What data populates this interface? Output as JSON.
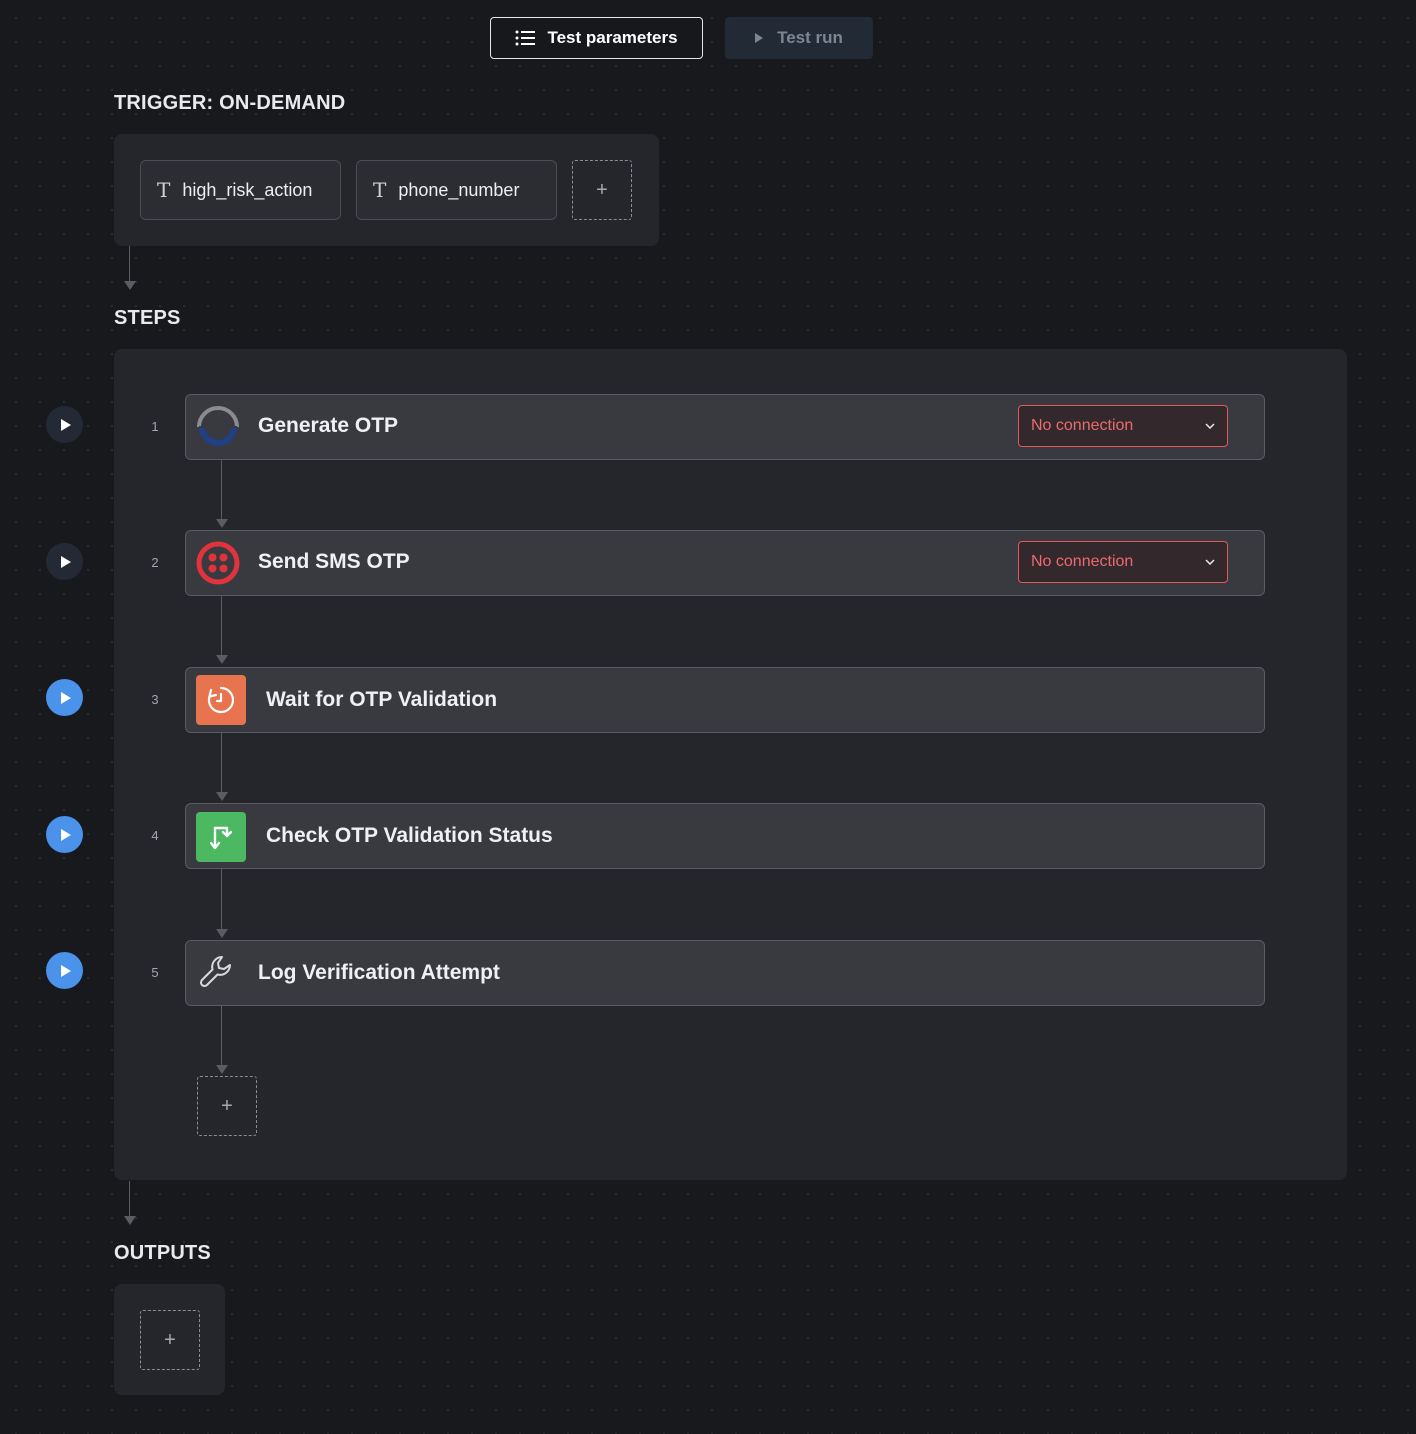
{
  "toolbar": {
    "test_parameters_label": "Test parameters",
    "test_run_label": "Test run"
  },
  "trigger": {
    "title": "TRIGGER: ON-DEMAND",
    "params": [
      {
        "name": "high_risk_action",
        "type_icon": "text-type-icon"
      },
      {
        "name": "phone_number",
        "type_icon": "text-type-icon"
      }
    ],
    "add_label": "+"
  },
  "steps": {
    "title": "STEPS",
    "items": [
      {
        "number": "1",
        "title": "Generate OTP",
        "icon": "loading-ring-icon",
        "connection": "No connection",
        "play_style": "inactive"
      },
      {
        "number": "2",
        "title": "Send SMS OTP",
        "icon": "twilio-icon",
        "connection": "No connection",
        "play_style": "inactive"
      },
      {
        "number": "3",
        "title": "Wait for OTP Validation",
        "icon": "timer-icon",
        "play_style": "active"
      },
      {
        "number": "4",
        "title": "Check OTP Validation Status",
        "icon": "branch-icon",
        "play_style": "active"
      },
      {
        "number": "5",
        "title": "Log Verification Attempt",
        "icon": "wrench-icon",
        "play_style": "active"
      }
    ],
    "add_label": "+"
  },
  "outputs": {
    "title": "OUTPUTS",
    "add_label": "+"
  },
  "colors": {
    "background": "#18191d",
    "panel": "#25262c",
    "card": "#393a40",
    "error": "#ec6a6e",
    "play_active": "#4a92ea",
    "timer_icon_bg": "#e8744f",
    "branch_icon_bg": "#4cb862",
    "twilio_red": "#e0333c"
  }
}
